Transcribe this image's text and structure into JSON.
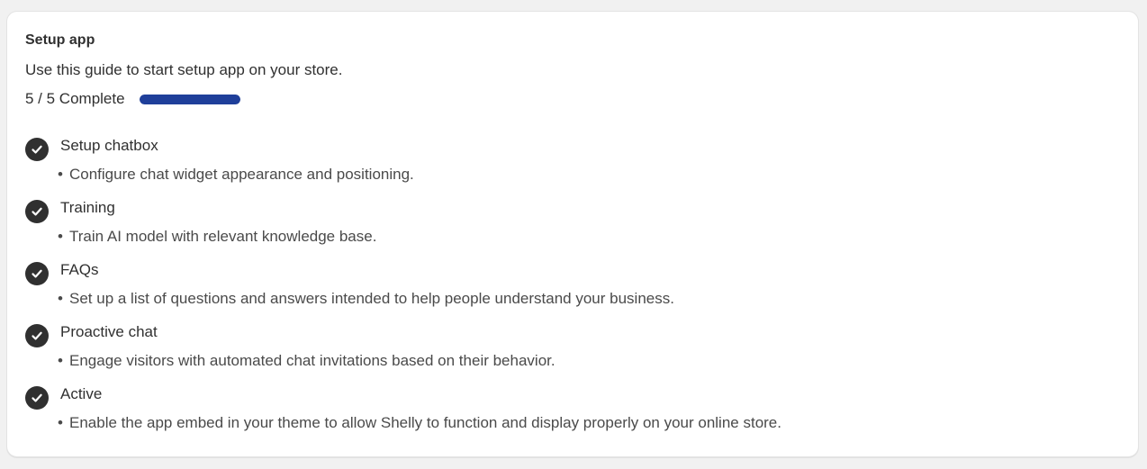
{
  "colors": {
    "accent": "#1f3f9a",
    "check_bg": "#303030",
    "check_mark": "#ffffff"
  },
  "card": {
    "title": "Setup app",
    "subtitle": "Use this guide to start setup app on your store.",
    "progress": {
      "label": "5 / 5 Complete",
      "completed": 5,
      "total": 5,
      "fraction": 1.0
    }
  },
  "steps": [
    {
      "title": "Setup chatbox",
      "bullet": "•",
      "description": "Configure chat widget appearance and positioning.",
      "icon": "check-circle-icon",
      "done": true
    },
    {
      "title": "Training",
      "bullet": "•",
      "description": "Train AI model with relevant knowledge base.",
      "icon": "check-circle-icon",
      "done": true
    },
    {
      "title": "FAQs",
      "bullet": "•",
      "description": "Set up a list of questions and answers intended to help people understand your business.",
      "icon": "check-circle-icon",
      "done": true
    },
    {
      "title": "Proactive chat",
      "bullet": "•",
      "description": "Engage visitors with automated chat invitations based on their behavior.",
      "icon": "check-circle-icon",
      "done": true
    },
    {
      "title": "Active",
      "bullet": "•",
      "description": "Enable the app embed in your theme to allow Shelly to function and display properly on your online store.",
      "icon": "check-circle-icon",
      "done": true
    }
  ]
}
